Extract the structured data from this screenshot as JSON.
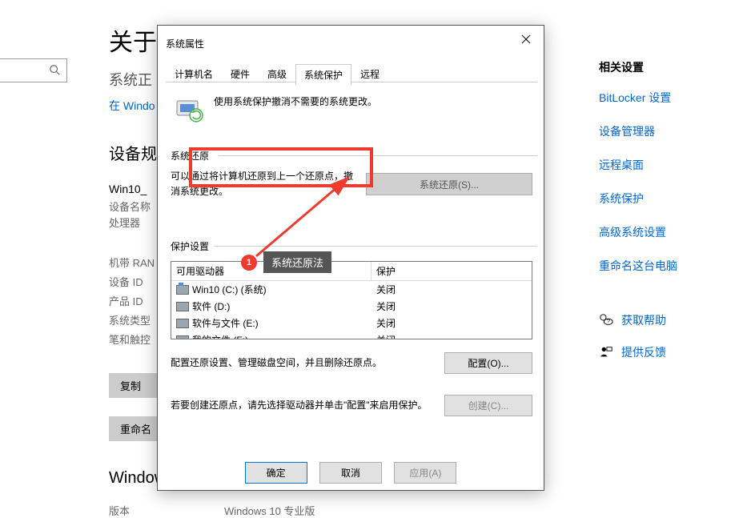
{
  "bg": {
    "title": "关于",
    "monitoring": "系统正",
    "windows_link": "在 Windo",
    "spec_heading": "设备规",
    "device_name_lbl": "Win10_",
    "device_name_sub": "设备名称",
    "cpu": "处理器",
    "ram": "机带 RAN",
    "device_id": "设备 ID",
    "product_id": "产品 ID",
    "sys_type": "系统类型",
    "pen": "笔和触控",
    "copy_btn": "复制",
    "rename_btn": "重命名",
    "win_heading": "Window",
    "version_lbl": "版本",
    "version_val": "Windows 10 专业版"
  },
  "related": {
    "heading": "相关设置",
    "links": [
      "BitLocker 设置",
      "设备管理器",
      "远程桌面",
      "系统保护",
      "高级系统设置",
      "重命名这台电脑"
    ],
    "help": "获取帮助",
    "feedback": "提供反馈"
  },
  "dialog": {
    "title": "系统属性",
    "tabs": [
      "计算机名",
      "硬件",
      "高级",
      "系统保护",
      "远程"
    ],
    "active_tab": 3,
    "intro": "使用系统保护撤消不需要的系统更改。",
    "restore": {
      "group": "系统还原",
      "text": "可以通过将计算机还原到上一个还原点，撤消系统更改。",
      "button": "系统还原(S)..."
    },
    "protect": {
      "group": "保护设置",
      "col_drive": "可用驱动器",
      "col_status": "保护",
      "drives": [
        {
          "name": "Win10 (C:) (系统)",
          "status": "关闭",
          "win": true
        },
        {
          "name": "软件 (D:)",
          "status": "关闭",
          "win": false
        },
        {
          "name": "软件与文件 (E:)",
          "status": "关闭",
          "win": false
        },
        {
          "name": "我的文件 (F:)",
          "status": "关闭",
          "win": false
        }
      ],
      "config_text": "配置还原设置、管理磁盘空间，并且删除还原点。",
      "config_btn": "配置(O)...",
      "create_text": "若要创建还原点，请先选择驱动器并单击\"配置\"来启用保护。",
      "create_btn": "创建(C)..."
    },
    "buttons": {
      "ok": "确定",
      "cancel": "取消",
      "apply": "应用(A)"
    }
  },
  "annotation": {
    "num": "1",
    "label": "系统还原法"
  }
}
